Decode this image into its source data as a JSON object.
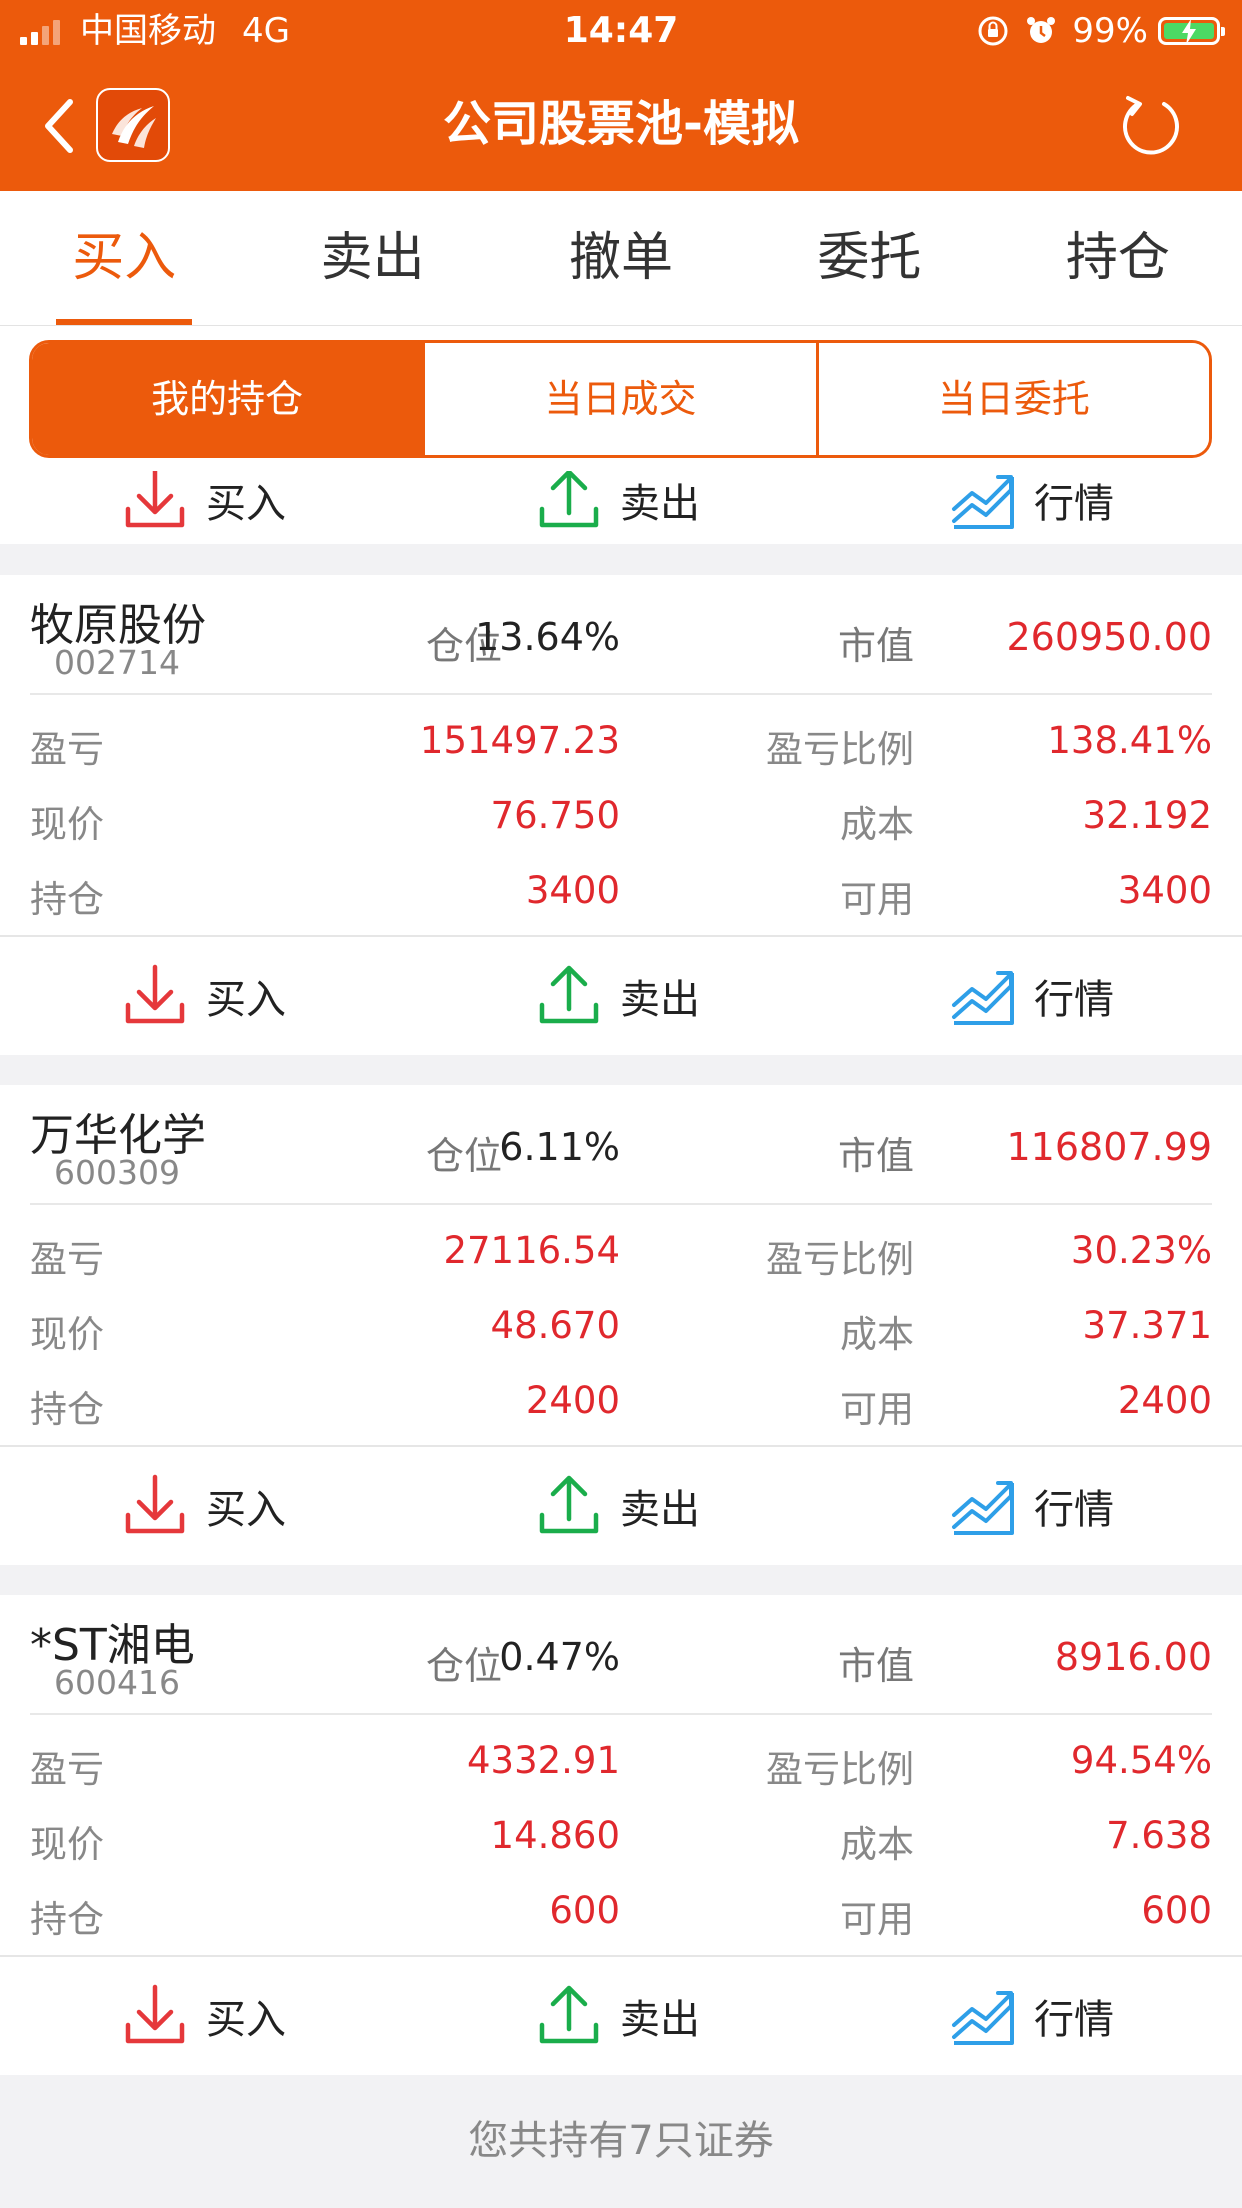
{
  "status_bar": {
    "carrier": "中国移动",
    "network": "4G",
    "time": "14:47",
    "battery": "99%",
    "battery_level": 0.99
  },
  "nav": {
    "title": "公司股票池-模拟",
    "icons": {
      "back": "chevron-left-icon",
      "logo": "app-logo",
      "refresh": "refresh-icon"
    }
  },
  "tabs": [
    {
      "label": "买入",
      "active": true
    },
    {
      "label": "卖出",
      "active": false
    },
    {
      "label": "撤单",
      "active": false
    },
    {
      "label": "委托",
      "active": false
    },
    {
      "label": "持仓",
      "active": false
    }
  ],
  "segments": [
    {
      "label": "我的持仓",
      "active": true
    },
    {
      "label": "当日成交",
      "active": false
    },
    {
      "label": "当日委托",
      "active": false
    }
  ],
  "actions": {
    "buy": "买入",
    "sell": "卖出",
    "quote": "行情"
  },
  "labels": {
    "position": "仓位",
    "market_value": "市值",
    "pnl": "盈亏",
    "pnl_ratio": "盈亏比例",
    "price": "现价",
    "cost": "成本",
    "holding": "持仓",
    "available": "可用"
  },
  "holdings": [
    {
      "name": "牧原股份",
      "code": "002714",
      "position": "13.64%",
      "market_value": "260950.00",
      "pnl": "151497.23",
      "pnl_ratio": "138.41%",
      "price": "76.750",
      "cost": "32.192",
      "holding": "3400",
      "available": "3400"
    },
    {
      "name": "万华化学",
      "code": "600309",
      "position": "6.11%",
      "market_value": "116807.99",
      "pnl": "27116.54",
      "pnl_ratio": "30.23%",
      "price": "48.670",
      "cost": "37.371",
      "holding": "2400",
      "available": "2400"
    },
    {
      "name": "*ST湘电",
      "code": "600416",
      "position": "0.47%",
      "market_value": "8916.00",
      "pnl": "4332.91",
      "pnl_ratio": "94.54%",
      "price": "14.860",
      "cost": "7.638",
      "holding": "600",
      "available": "600"
    }
  ],
  "footer": "您共持有7只证券",
  "colors": {
    "brand": "#ec5a0c",
    "up_red": "#e0282d",
    "buy_icon": "#e5383b",
    "sell_icon": "#1aad4b",
    "quote_icon": "#2e9fe8"
  }
}
